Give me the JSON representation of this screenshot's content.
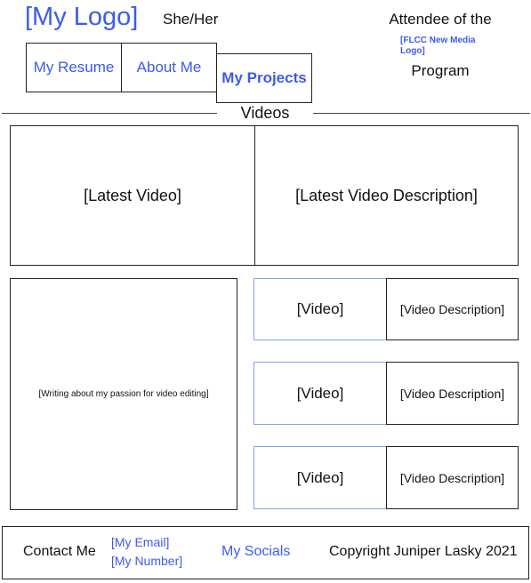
{
  "header": {
    "logo": "[My Logo]",
    "pronouns": "She/Her",
    "attendee_line": "Attendee of the",
    "program_logo": "[FLCC New Media Logo]",
    "program_line": "Program"
  },
  "nav": {
    "tabs": [
      {
        "label": "My Resume"
      },
      {
        "label": "About Me"
      },
      {
        "label": "My Projects"
      }
    ]
  },
  "section": {
    "title": "Videos"
  },
  "featured": {
    "video": "[Latest Video]",
    "description": "[Latest Video Description]"
  },
  "writing": "[Writing about my passion for video editing]",
  "videos": [
    {
      "video": "[Video]",
      "description": "[Video Description]"
    },
    {
      "video": "[Video]",
      "description": "[Video Description]"
    },
    {
      "video": "[Video]",
      "description": "[Video Description]"
    }
  ],
  "footer": {
    "contact": "Contact Me",
    "email": "[My Email]",
    "number": "[My Number]",
    "socials": "My Socials",
    "copyright": "Copyright Juniper Lasky 2021"
  },
  "colors": {
    "link": "#3b5bf0",
    "border": "#222222",
    "video_border": "#8aa0f0"
  }
}
